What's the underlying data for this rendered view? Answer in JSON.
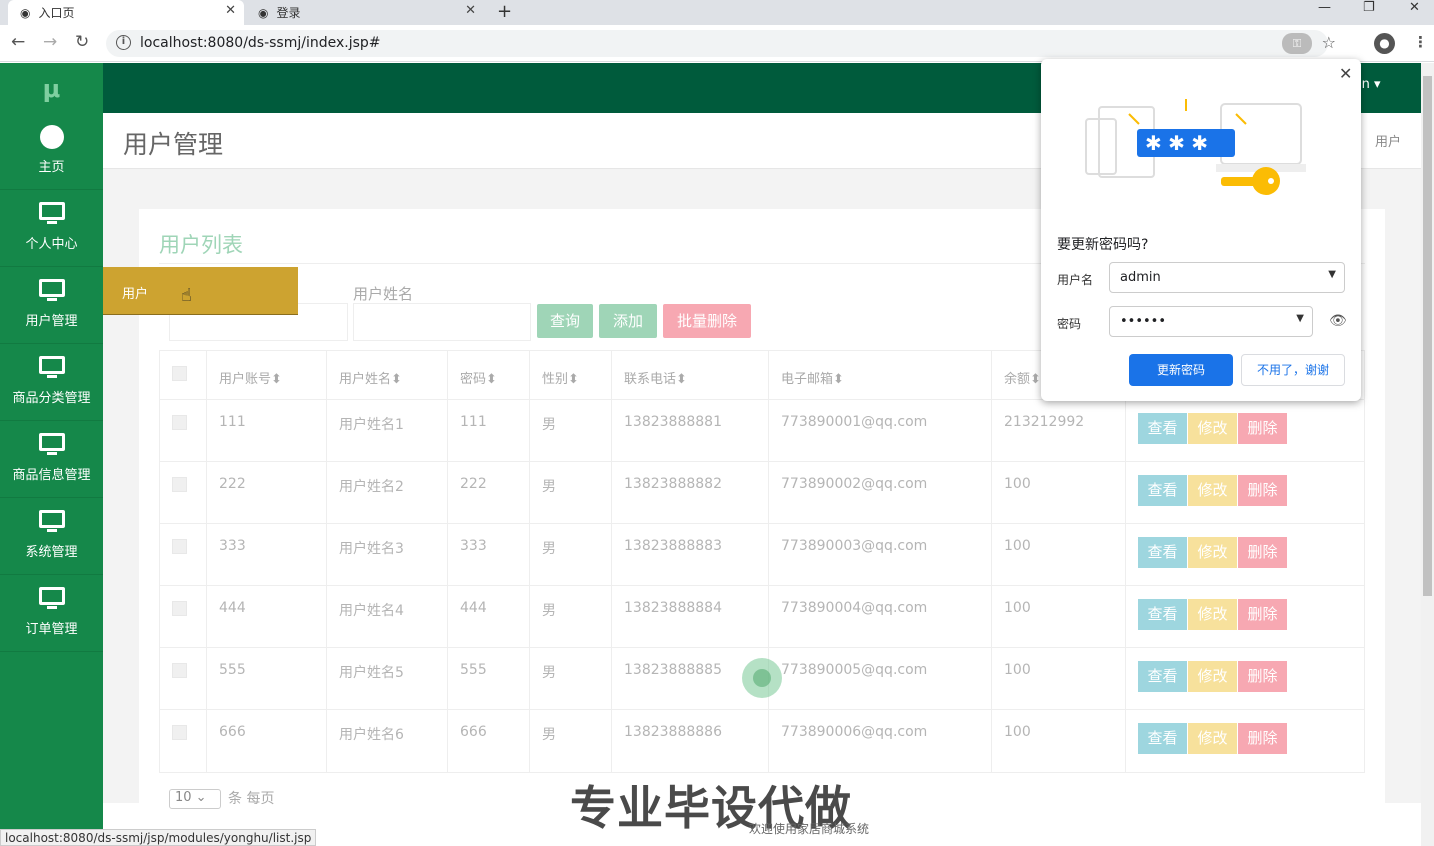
{
  "browser": {
    "tabs": [
      {
        "label": "入口页"
      },
      {
        "label": "登录"
      }
    ],
    "url": "localhost:8080/ds-ssmj/index.jsp#",
    "status_url": "localhost:8080/ds-ssmj/jsp/modules/yonghu/list.jsp"
  },
  "sidebar": {
    "logo": "μ",
    "items": [
      {
        "label": "主页",
        "icon": "dashboard-icon"
      },
      {
        "label": "个人中心",
        "icon": "monitor-icon"
      },
      {
        "label": "用户管理",
        "icon": "monitor-icon"
      },
      {
        "label": "商品分类管理",
        "icon": "monitor-icon"
      },
      {
        "label": "商品信息管理",
        "icon": "monitor-icon"
      },
      {
        "label": "系统管理",
        "icon": "monitor-icon"
      },
      {
        "label": "订单管理",
        "icon": "monitor-icon"
      }
    ],
    "flyout_label": "用户"
  },
  "header": {
    "user": "in ▾",
    "page_title": "用户管理",
    "breadcrumb": "用户"
  },
  "card": {
    "title": "用户列表",
    "search_label": "用户姓名",
    "buttons": {
      "query": "查询",
      "add": "添加",
      "batch_delete": "批量删除"
    }
  },
  "table": {
    "headers": [
      "用户账号",
      "用户姓名",
      "密码",
      "性别",
      "联系电话",
      "电子邮箱",
      "余额"
    ],
    "rows": [
      [
        "111",
        "用户姓名1",
        "111",
        "男",
        "13823888881",
        "773890001@qq.com",
        "213212992"
      ],
      [
        "222",
        "用户姓名2",
        "222",
        "男",
        "13823888882",
        "773890002@qq.com",
        "100"
      ],
      [
        "333",
        "用户姓名3",
        "333",
        "男",
        "13823888883",
        "773890003@qq.com",
        "100"
      ],
      [
        "444",
        "用户姓名4",
        "444",
        "男",
        "13823888884",
        "773890004@qq.com",
        "100"
      ],
      [
        "555",
        "用户姓名5",
        "555",
        "男",
        "13823888885",
        "773890005@qq.com",
        "100"
      ],
      [
        "666",
        "用户姓名6",
        "666",
        "男",
        "13823888886",
        "773890006@qq.com",
        "100"
      ]
    ],
    "actions": {
      "view": "查看",
      "edit": "修改",
      "delete": "删除"
    },
    "sort_glyph": "⬍"
  },
  "pager": {
    "page_size": "10",
    "text": "条 每页"
  },
  "watermark": {
    "main": "专业毕设代做",
    "sub": "欢迎使用家居商城系统"
  },
  "password_popup": {
    "title": "要更新密码吗?",
    "username_label": "用户名",
    "username": "admin",
    "password_label": "密码",
    "password_mask": "••••••",
    "update_label": "更新密码",
    "decline_label": "不用了，谢谢"
  },
  "colors": {
    "sidebar": "#15884a",
    "topbar": "#005b3c",
    "flyout": "#cda330",
    "primary_button": "#1a73e8"
  }
}
